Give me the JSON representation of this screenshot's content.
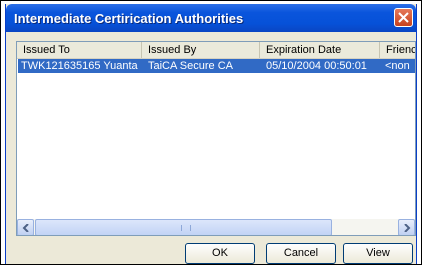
{
  "window": {
    "title": "Intermediate Certirication Authorities"
  },
  "list": {
    "columns": [
      {
        "label": "Issued To"
      },
      {
        "label": "Issued By"
      },
      {
        "label": "Expiration Date"
      },
      {
        "label": "Frienc"
      }
    ],
    "rows": [
      {
        "issued_to": "TWK121635165 Yuanta",
        "issued_by": "TaiCA Secure CA",
        "expiration": "05/10/2004 00:50:01",
        "friendly": "<non"
      }
    ],
    "selected_row": 0
  },
  "buttons": {
    "ok": "OK",
    "cancel": "Cancel",
    "view": "View"
  },
  "colors": {
    "titlebar": "#0a55dc",
    "selection": "#316ac5",
    "close": "#c8421e"
  }
}
